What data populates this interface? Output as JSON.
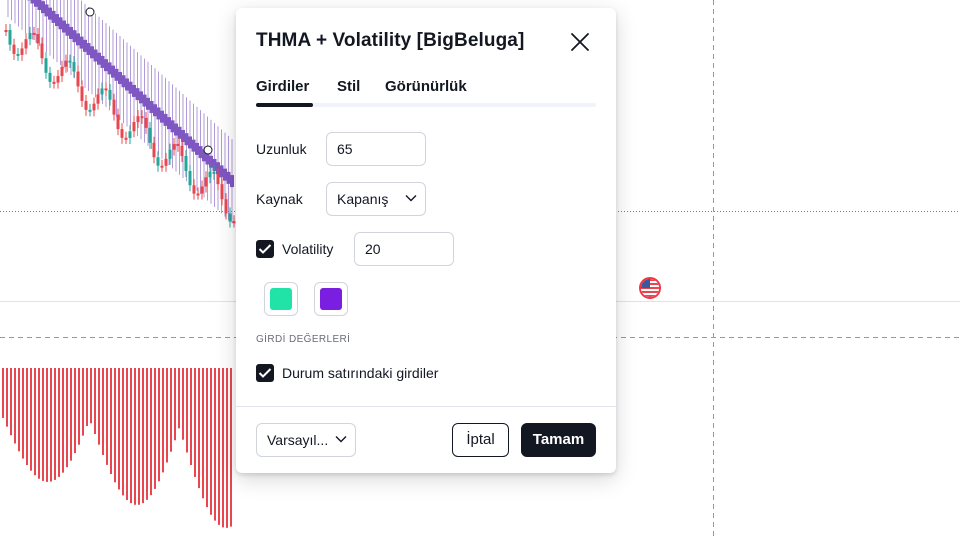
{
  "dialog": {
    "title": "THMA + Volatility [BigBeluga]",
    "tabs": [
      {
        "label": "Girdiler",
        "active": true
      },
      {
        "label": "Stil",
        "active": false
      },
      {
        "label": "Görünürlük",
        "active": false
      }
    ],
    "inputs": {
      "length": {
        "label": "Uzunluk",
        "value": "65"
      },
      "source": {
        "label": "Kaynak",
        "value": "Kapanış"
      },
      "volatility": {
        "label": "Volatility",
        "value": "20",
        "checked": true
      }
    },
    "colors": {
      "color_1": "#22e3a7",
      "color_2": "#7a1fe0"
    },
    "section_label": "GİRDİ DEĞERLERİ",
    "status_line_inputs": {
      "label": "Durum satırındaki girdiler",
      "checked": true
    },
    "footer": {
      "defaults_label": "Varsayıl...",
      "cancel_label": "İptal",
      "ok_label": "Tamam"
    }
  },
  "chart": {
    "bullish_color": "#26a69a",
    "bearish_color": "#e8474f",
    "band_color": "#7e57c2",
    "histogram_color": "#e8474f"
  }
}
